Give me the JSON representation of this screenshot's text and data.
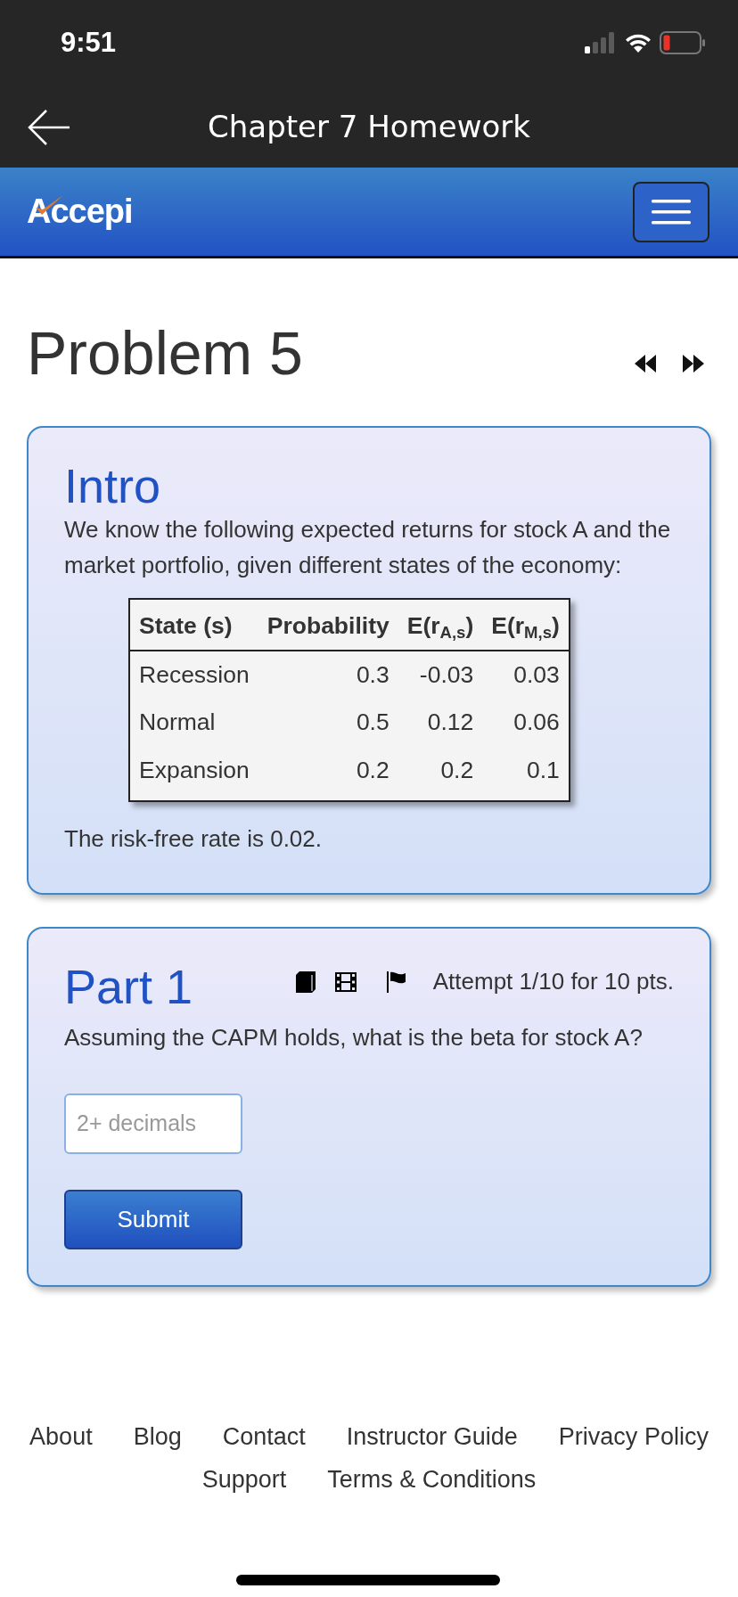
{
  "status_bar": {
    "time": "9:51"
  },
  "app_bar": {
    "title": "Chapter 7 Homework"
  },
  "navbar": {
    "brand": "Accepi"
  },
  "problem": {
    "title": "Problem 5"
  },
  "intro": {
    "heading": "Intro",
    "text": "We know the following expected returns for stock A and the market portfolio, given different states of the economy:",
    "table": {
      "columns": [
        "State (s)",
        "Probability",
        "E(r$_{A,s}$)",
        "E(r$_{M,s}$)"
      ],
      "rows": [
        [
          "Recession",
          "0.3",
          "-0.03",
          "0.03"
        ],
        [
          "Normal",
          "0.5",
          "0.12",
          "0.06"
        ],
        [
          "Expansion",
          "0.2",
          "0.2",
          "0.1"
        ]
      ]
    },
    "note": "The risk-free rate is 0.02."
  },
  "part": {
    "heading": "Part 1",
    "attempt": "Attempt 1/10 for 10 pts.",
    "question": "Assuming the CAPM holds, what is the beta for stock A?",
    "answer": {
      "placeholder": "2+ decimals"
    },
    "submit": "Submit"
  },
  "footer": {
    "links": [
      "About",
      "Blog",
      "Contact",
      "Instructor Guide",
      "Privacy Policy",
      "Support",
      "Terms & Conditions"
    ]
  }
}
